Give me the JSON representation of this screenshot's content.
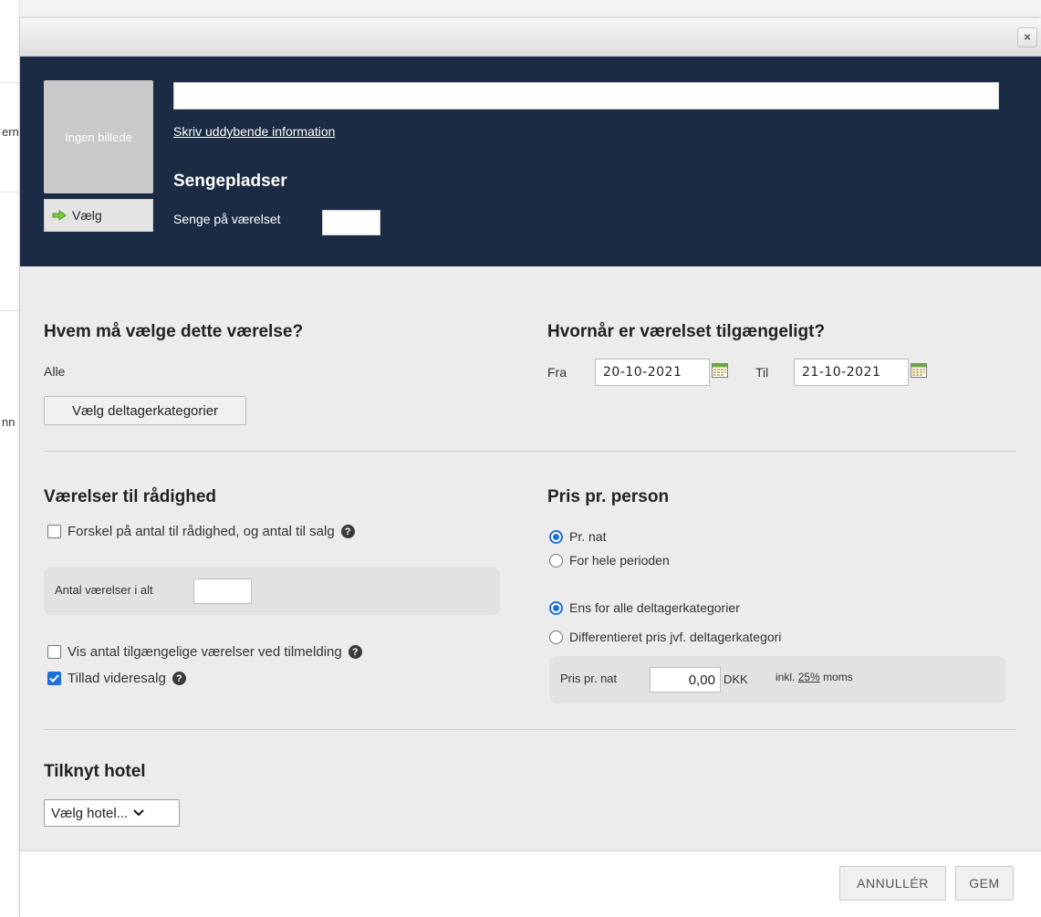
{
  "background_fragments": [
    "ern",
    "nn"
  ],
  "dialog": {
    "close_symbol": "×",
    "header": {
      "image_placeholder": "Ingen billede",
      "choose_button": "Vælg",
      "name_value": "",
      "info_link": "Skriv uddybende information",
      "beds_title": "Sengepladser",
      "beds_label": "Senge på værelset",
      "beds_value": ""
    },
    "who": {
      "title": "Hvem må vælge dette værelse?",
      "value": "Alle",
      "button": "Vælg deltagerkategorier"
    },
    "when": {
      "title": "Hvornår er værelset tilgængeligt?",
      "from_label": "Fra",
      "from_value": "20-10-2021",
      "to_label": "Til",
      "to_value": "21-10-2021"
    },
    "rooms": {
      "title": "Værelser til rådighed",
      "difference_label": "Forskel på antal til rådighed, og antal til salg",
      "difference_checked": false,
      "total_label": "Antal værelser i alt",
      "total_value": "",
      "show_available_label": "Vis antal tilgængelige værelser ved tilmelding",
      "show_available_checked": false,
      "resale_label": "Tillad videresalg",
      "resale_checked": true
    },
    "price": {
      "title": "Pris pr. person",
      "period_options": [
        "Pr. nat",
        "For hele perioden"
      ],
      "period_selected": "Pr. nat",
      "category_options": [
        "Ens for alle deltagerkategorier",
        "Differentieret pris jvf. deltagerkategori"
      ],
      "category_selected": "Ens for alle deltagerkategorier",
      "night_label": "Pris pr. nat",
      "night_value": "0,00",
      "currency": "DKK",
      "vat_prefix": "inkl.",
      "vat_rate": "25%",
      "vat_suffix": "moms"
    },
    "hotel": {
      "title": "Tilknyt hotel",
      "selected": "Vælg hotel..."
    },
    "footer": {
      "cancel": "ANNULLÉR",
      "save": "GEM"
    },
    "colors": {
      "header_bg": "#1b2b44",
      "accent": "#1e6fd9",
      "arrow": "#7ac943"
    }
  }
}
